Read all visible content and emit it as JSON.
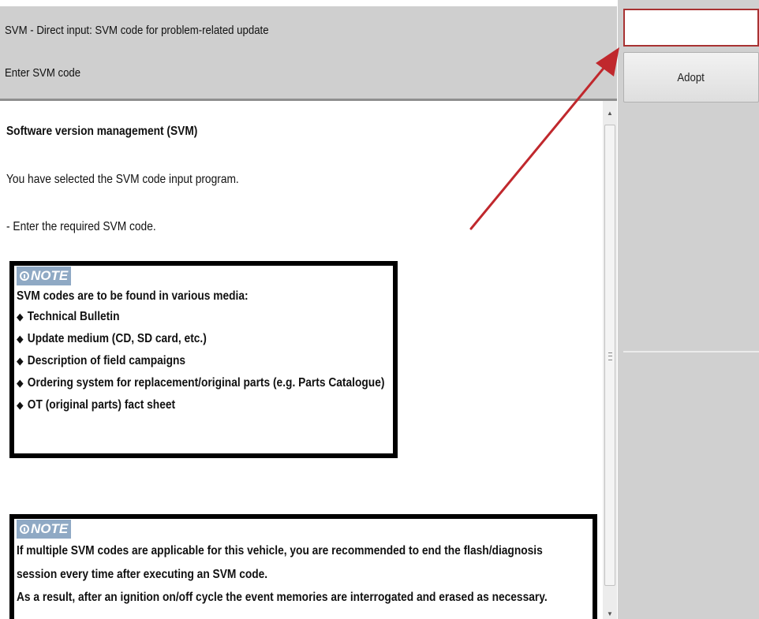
{
  "header": {
    "title": "SVM - Direct input: SVM code for problem-related update",
    "subtitle": "Enter SVM code"
  },
  "side_panel": {
    "code_input": {
      "value": "",
      "placeholder": ""
    },
    "adopt_label": "Adopt"
  },
  "content": {
    "heading": "Software version management (SVM)",
    "paragraphs": [
      "You have selected the SVM code input program.",
      "- Enter the required SVM code."
    ],
    "note1": {
      "tag": "NOTE",
      "intro": "SVM codes are to be found in various media:",
      "items": [
        "Technical Bulletin",
        "Update medium (CD, SD card, etc.)",
        "Description of field campaigns",
        "Ordering system for replacement/original parts (e.g. Parts Catalogue)",
        "OT (original parts) fact sheet"
      ]
    },
    "note2": {
      "tag": "NOTE",
      "lines": [
        "If multiple SVM codes are applicable for this vehicle, you are recommended to end the flash/diagnosis",
        "session every time after executing an SVM code.",
        "As a result, after an ignition on/off cycle the event memories are interrogated and erased as necessary."
      ]
    }
  },
  "icons": {
    "note_icon": "info-circle-icon",
    "bullet_icon": "diamond-bullet-icon",
    "scroll_up": "chevron-up-icon",
    "scroll_down": "chevron-down-icon",
    "annotation": "red-arrow-icon"
  },
  "colors": {
    "header_bg": "#cfcfcf",
    "panel_bg": "#d0d0d0",
    "note_tag_bg": "#8fa9c4",
    "annotation_red": "#c0282d",
    "input_border": "#a83232"
  }
}
